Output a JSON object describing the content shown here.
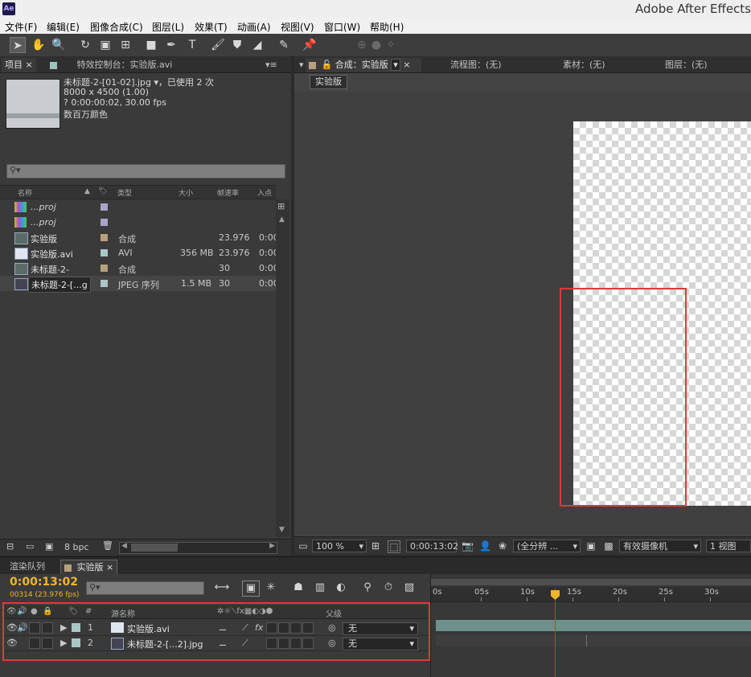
{
  "app": {
    "logo": "Ae",
    "title": "Adobe After Effects"
  },
  "menu": [
    "文件(F)",
    "编辑(E)",
    "图像合成(C)",
    "图层(L)",
    "效果(T)",
    "动画(A)",
    "视图(V)",
    "窗口(W)",
    "帮助(H)"
  ],
  "project": {
    "tab_project": "项目",
    "tab_effects": "特效控制台：实验版.avi",
    "selected_info": {
      "name": "未标题-2-[01-02].jpg",
      "used": "▾，已使用 2 次",
      "dims": "8000 x 4500 (1.00)",
      "duration": "? 0:00:00:02, 30.00 fps",
      "color": "数百万颜色"
    },
    "columns": {
      "name": "名称",
      "type": "类型",
      "size": "大小",
      "fps": "帧速率",
      "in": "入点"
    },
    "items": [
      {
        "name": "...proj",
        "type": "",
        "size": "",
        "fps": "",
        "in": "",
        "label_color": "#a9a3cc",
        "icon": "project-icon"
      },
      {
        "name": "...proj",
        "type": "",
        "size": "",
        "fps": "",
        "in": "",
        "label_color": "#a9a3cc",
        "icon": "project-icon"
      },
      {
        "name": "实验版",
        "type": "合成",
        "size": "",
        "fps": "23.976",
        "in": "0:00",
        "label_color": "#b8a07a",
        "icon": "composition-icon"
      },
      {
        "name": "实验版.avi",
        "type": "AVI",
        "size": "356 MB",
        "fps": "23.976",
        "in": "0:00",
        "label_color": "#a9c7c4",
        "icon": "footage-icon"
      },
      {
        "name": "未标题-2-",
        "type": "合成",
        "size": "",
        "fps": "30",
        "in": "0:00",
        "label_color": "#b8a07a",
        "icon": "composition-icon"
      },
      {
        "name": "未标题-2-[...g",
        "type": "JPEG 序列",
        "size": "1.5 MB",
        "fps": "30",
        "in": "0:00",
        "label_color": "#a9c7c4",
        "icon": "image-sequence-icon"
      }
    ],
    "footer_bpc": "8 bpc"
  },
  "comp": {
    "tab_comp": "合成：实验版",
    "tab_flow": "流程图：(无)",
    "tab_footage": "素材：(无)",
    "tab_layer": "图层：(无)",
    "name_button": "实验版",
    "zoom": "100 %",
    "timecode": "0:00:13:02",
    "resolution": "(全分辨 ...",
    "camera": "有效摄像机",
    "views": "1 视图"
  },
  "timeline": {
    "tab_render": "渲染队列",
    "tab_comp": "实验版",
    "timecode": "0:00:13:02",
    "frames": "00314 (23.976 fps)",
    "headers": {
      "number": "#",
      "source": "源名称",
      "parent": "父级"
    },
    "ruler": [
      "0s",
      "05s",
      "10s",
      "15s",
      "20s",
      "25s",
      "30s"
    ],
    "layers": [
      {
        "number": "1",
        "name": "实验版.avi",
        "parent": "无",
        "icon": "footage-icon",
        "label_color": "#a9c7c4"
      },
      {
        "number": "2",
        "name": "未标题-2-[...2].jpg",
        "parent": "无",
        "icon": "image-sequence-icon",
        "label_color": "#a9c7c4"
      }
    ]
  }
}
